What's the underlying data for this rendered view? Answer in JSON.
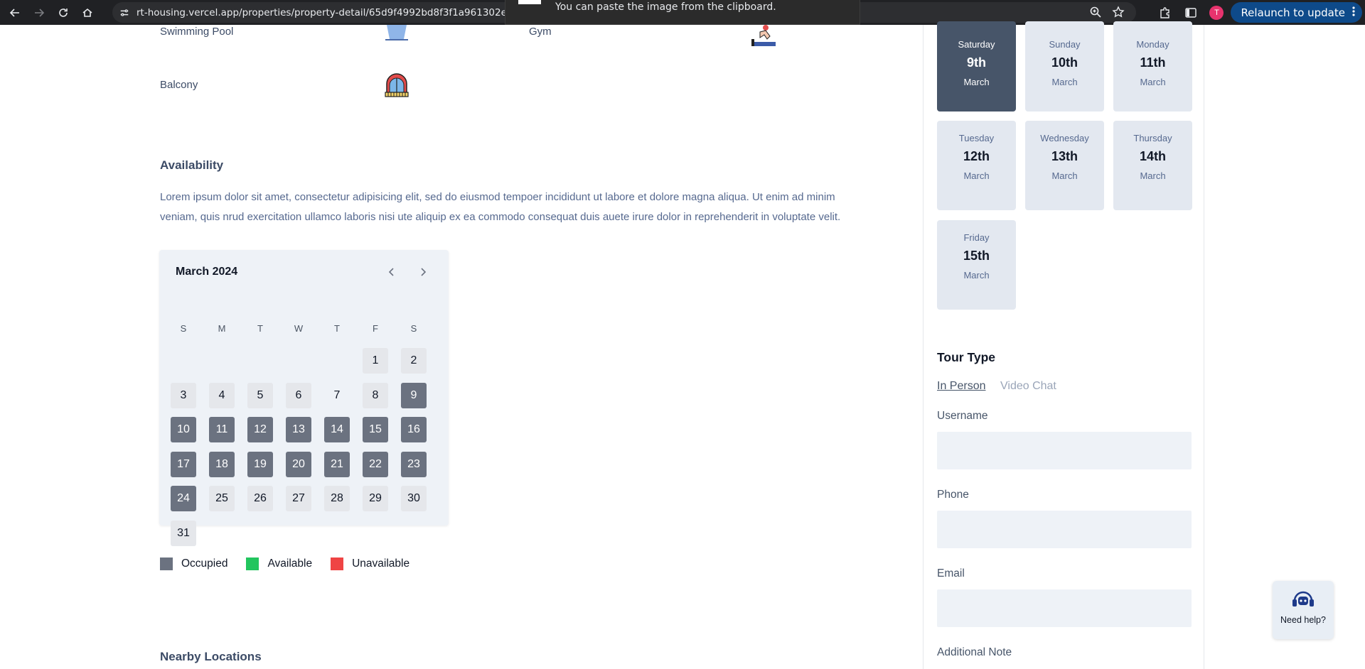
{
  "browser": {
    "url": "rt-housing.vercel.app/properties/property-detail/65d9f4992bd8f3f1a961302e",
    "toast": "You can paste the image from the clipboard.",
    "profile_initial": "T",
    "relaunch_label": "Relaunch to update"
  },
  "amenities": {
    "swimming_pool": "Swimming Pool",
    "gym": "Gym",
    "balcony": "Balcony"
  },
  "availability": {
    "heading": "Availability",
    "description": "Lorem ipsum dolor sit amet, consectetur adipisicing elit, sed do eiusmod tempoer incididunt ut labore et dolore magna aliqua. Ut enim ad minim veniam, quis nrud exercitation ullamco laboris nisi ute aliquip ex ea commodo consequat duis auete irure dolor in reprehenderit in voluptate velit."
  },
  "calendar": {
    "title": "March 2024",
    "weekdays": [
      "S",
      "M",
      "T",
      "W",
      "T",
      "F",
      "S"
    ],
    "days": [
      {
        "n": "1",
        "s": "free"
      },
      {
        "n": "2",
        "s": "free"
      },
      {
        "n": "3",
        "s": "free"
      },
      {
        "n": "4",
        "s": "free"
      },
      {
        "n": "5",
        "s": "free"
      },
      {
        "n": "6",
        "s": "free"
      },
      {
        "n": "7",
        "s": "plain"
      },
      {
        "n": "8",
        "s": "free"
      },
      {
        "n": "9",
        "s": "occ"
      },
      {
        "n": "10",
        "s": "occ"
      },
      {
        "n": "11",
        "s": "occ"
      },
      {
        "n": "12",
        "s": "occ"
      },
      {
        "n": "13",
        "s": "occ"
      },
      {
        "n": "14",
        "s": "occ"
      },
      {
        "n": "15",
        "s": "occ"
      },
      {
        "n": "16",
        "s": "occ"
      },
      {
        "n": "17",
        "s": "occ"
      },
      {
        "n": "18",
        "s": "occ"
      },
      {
        "n": "19",
        "s": "occ"
      },
      {
        "n": "20",
        "s": "occ"
      },
      {
        "n": "21",
        "s": "occ"
      },
      {
        "n": "22",
        "s": "occ"
      },
      {
        "n": "23",
        "s": "occ"
      },
      {
        "n": "24",
        "s": "occ"
      },
      {
        "n": "25",
        "s": "free"
      },
      {
        "n": "26",
        "s": "free"
      },
      {
        "n": "27",
        "s": "free"
      },
      {
        "n": "28",
        "s": "free"
      },
      {
        "n": "29",
        "s": "free"
      },
      {
        "n": "30",
        "s": "free"
      },
      {
        "n": "31",
        "s": "free"
      }
    ],
    "first_weekday": 5
  },
  "legend": {
    "occupied": "Occupied",
    "available": "Available",
    "unavailable": "Unavailable",
    "colors": {
      "occupied": "#6b7280",
      "available": "#22c55e",
      "unavailable": "#ef4444"
    }
  },
  "dates": [
    {
      "day": "Saturday",
      "num": "9th",
      "month": "March",
      "selected": true
    },
    {
      "day": "Sunday",
      "num": "10th",
      "month": "March",
      "selected": false
    },
    {
      "day": "Monday",
      "num": "11th",
      "month": "March",
      "selected": false
    },
    {
      "day": "Tuesday",
      "num": "12th",
      "month": "March",
      "selected": false
    },
    {
      "day": "Wednesday",
      "num": "13th",
      "month": "March",
      "selected": false
    },
    {
      "day": "Thursday",
      "num": "14th",
      "month": "March",
      "selected": false
    },
    {
      "day": "Friday",
      "num": "15th",
      "month": "March",
      "selected": false
    }
  ],
  "tour": {
    "heading": "Tour Type",
    "tab_in_person": "In Person",
    "tab_video_chat": "Video Chat",
    "username_label": "Username",
    "phone_label": "Phone",
    "email_label": "Email",
    "note_label": "Additional Note",
    "username_value": "",
    "phone_value": "",
    "email_value": ""
  },
  "help": {
    "label": "Need help?"
  }
}
